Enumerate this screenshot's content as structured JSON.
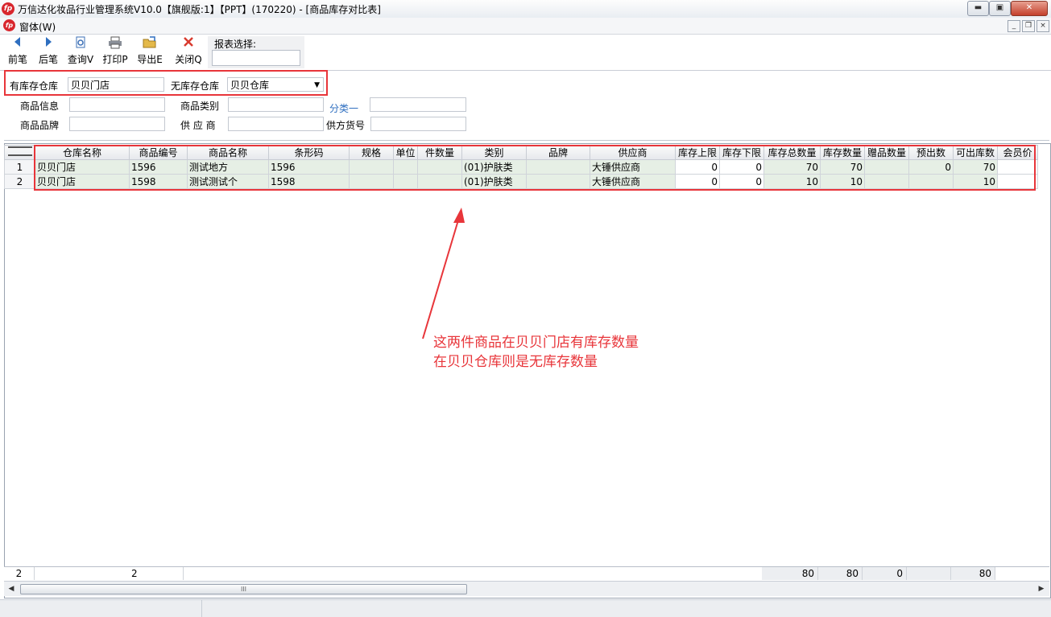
{
  "window": {
    "title": "万信达化妆品行业管理系统V10.0【旗舰版:1】【PPT】(170220) - [商品库存对比表]",
    "logo_text": "fp",
    "btn_min": "▬",
    "btn_max": "▣",
    "btn_close": "✕"
  },
  "menu": {
    "window_label": "窗体(W)",
    "btn_min": "_",
    "btn_restore": "❐",
    "btn_close": "×"
  },
  "toolbar": {
    "prev": "前笔",
    "next": "后笔",
    "query": "查询V",
    "print": "打印P",
    "export": "导出E",
    "close": "关闭Q",
    "report_label": "报表选择:"
  },
  "filters": {
    "has_stock_wh_label": "有库存仓库",
    "has_stock_wh_value": "贝贝门店",
    "no_stock_wh_label": "无库存仓库",
    "no_stock_wh_value": "贝贝仓库",
    "product_info_label": "商品信息",
    "product_category_label": "商品类别",
    "class1_label": "分类一",
    "product_brand_label": "商品品牌",
    "supplier_label": "供 应 商",
    "supplier_item_no_label": "供方货号"
  },
  "grid": {
    "columns": [
      "仓库名称",
      "商品编号",
      "商品名称",
      "条形码",
      "规格",
      "单位",
      "件数量",
      "类别",
      "品牌",
      "供应商",
      "库存上限",
      "库存下限",
      "库存总数量",
      "库存数量",
      "赠品数量",
      "预出数",
      "可出库数",
      "会员价"
    ],
    "rows": [
      {
        "no": "1",
        "wh": "贝贝门店",
        "code": "1596",
        "name": "测试地方",
        "barcode": "1596",
        "spec": "",
        "unit": "",
        "pcs": "",
        "cat": "(01)护肤类",
        "brand": "",
        "supplier": "大锤供应商",
        "max": "0",
        "min": "0",
        "total": "70",
        "qty": "70",
        "gift": "",
        "pre": "0",
        "avail": "70",
        "vip": ""
      },
      {
        "no": "2",
        "wh": "贝贝门店",
        "code": "1598",
        "name": "测试测试个",
        "barcode": "1598",
        "spec": "",
        "unit": "",
        "pcs": "",
        "cat": "(01)护肤类",
        "brand": "",
        "supplier": "大锤供应商",
        "max": "0",
        "min": "0",
        "total": "10",
        "qty": "10",
        "gift": "",
        "pre": "",
        "avail": "10",
        "vip": ""
      }
    ]
  },
  "footer": {
    "row_count": "2",
    "code_count": "2",
    "total_sum": "80",
    "qty_sum": "80",
    "gift_sum": "0",
    "avail_sum": "80"
  },
  "annotation": {
    "line1": "这两件商品在贝贝门店有库存数量",
    "line2": "在贝贝仓库则是无库存数量",
    "color": "#e8353a"
  },
  "scroll_grip": "III"
}
